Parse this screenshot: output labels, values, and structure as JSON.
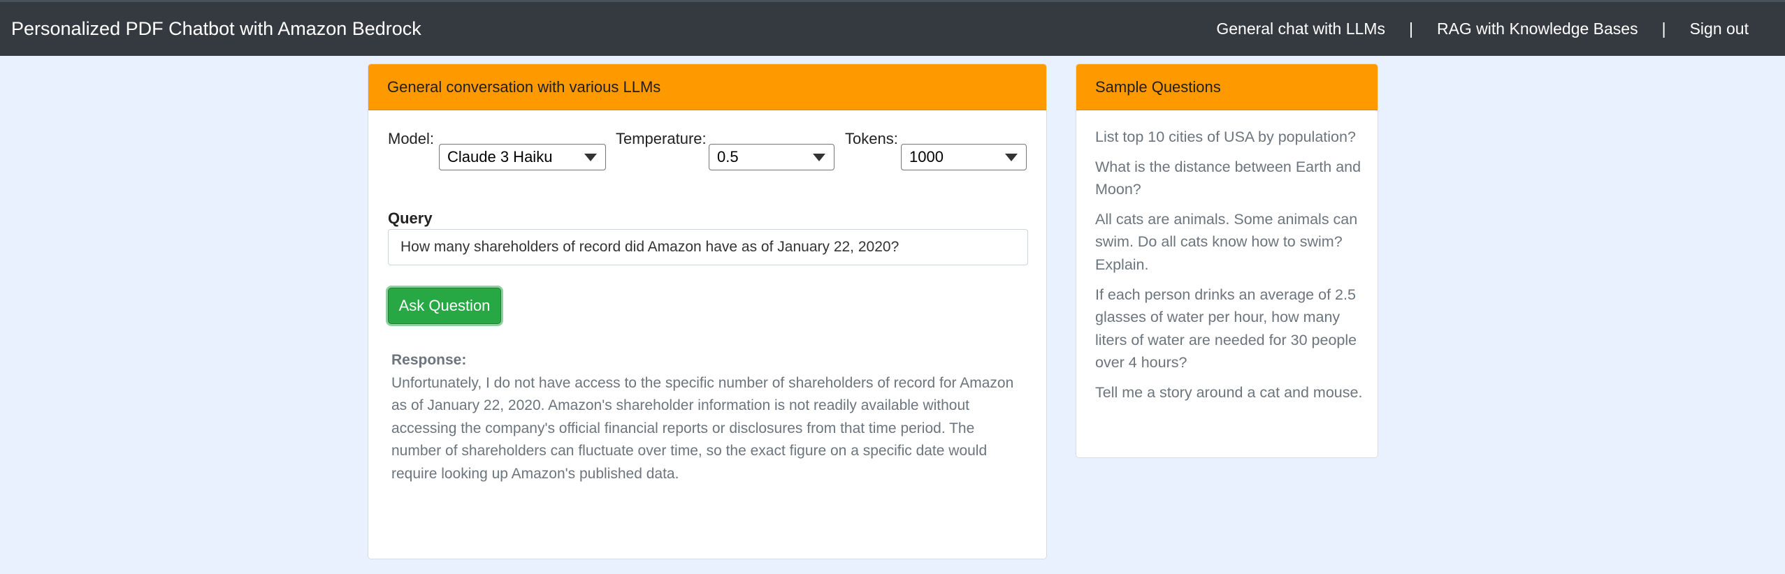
{
  "navbar": {
    "brand": "Personalized PDF Chatbot with Amazon Bedrock",
    "links": [
      {
        "label": "General chat with LLMs"
      },
      {
        "label": "RAG with Knowledge Bases"
      },
      {
        "label": "Sign out"
      }
    ],
    "separator": "|"
  },
  "main": {
    "header": "General conversation with various LLMs",
    "model_label": "Model:",
    "model_value": "Claude 3 Haiku",
    "temperature_label": "Temperature:",
    "temperature_value": "0.5",
    "tokens_label": "Tokens:",
    "tokens_value": "1000",
    "query_label": "Query",
    "query_value": "How many shareholders of record did Amazon have as of January 22, 2020?",
    "ask_button": "Ask Question",
    "response_label": "Response:",
    "response_text": "Unfortunately, I do not have access to the specific number of shareholders of record for Amazon as of January 22, 2020. Amazon's shareholder information is not readily available without accessing the company's official financial reports or disclosures from that time period. The number of shareholders can fluctuate over time, so the exact figure on a specific date would require looking up Amazon's published data."
  },
  "sidebar": {
    "header": "Sample Questions",
    "questions": [
      "List top 10 cities of USA by population?",
      "What is the distance between Earth and Moon?",
      "All cats are animals. Some animals can swim. Do all cats know how to swim? Explain.",
      "If each person drinks an average of 2.5 glasses of water per hour, how many liters of water are needed for 30 people over 4 hours?",
      "Tell me a story around a cat and mouse."
    ]
  },
  "colors": {
    "navbar_bg": "#343a40",
    "page_bg": "#e8f1fd",
    "card_header": "#ff9900",
    "button_green": "#28a745",
    "muted_text": "#6c757d"
  }
}
